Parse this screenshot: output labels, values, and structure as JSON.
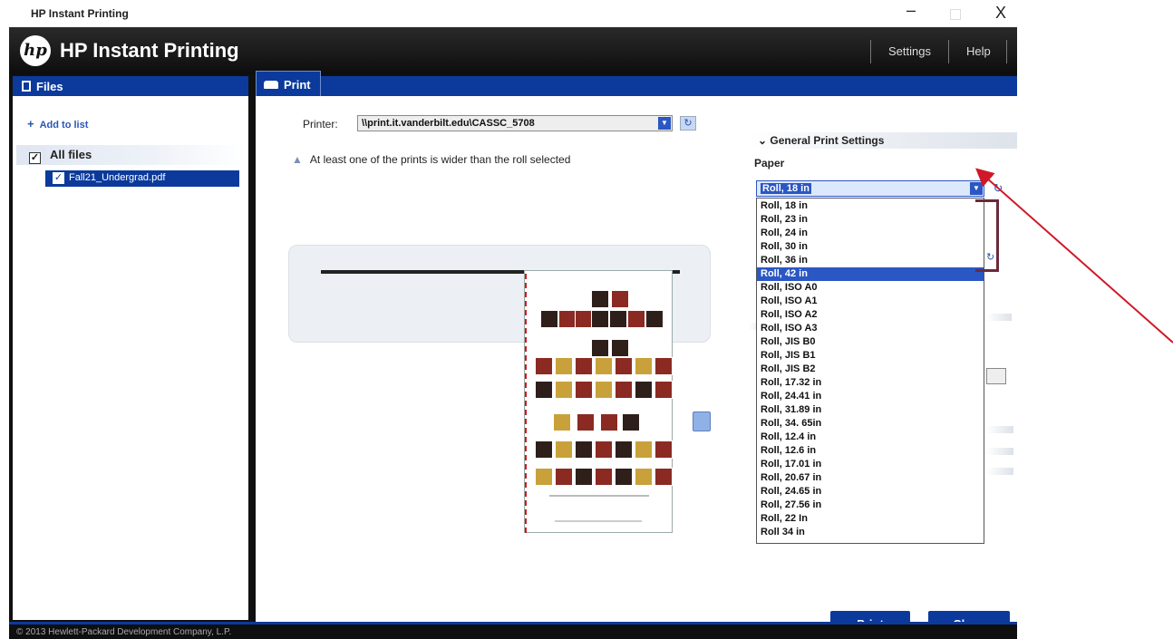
{
  "window": {
    "title": "HP Instant Printing",
    "minimize": "–",
    "maximize": "",
    "close": "X"
  },
  "header": {
    "logo": "hp",
    "title": "HP Instant Printing",
    "settings": "Settings",
    "help": "Help"
  },
  "files_pane": {
    "title": "Files",
    "add_to_list": "Add to list",
    "all_files": "All files",
    "files": [
      {
        "name": "Fall21_Undergrad.pdf",
        "checked": true
      }
    ]
  },
  "print_tab": {
    "label": "Print",
    "printer_label": "Printer:",
    "printer_value": "\\\\print.it.vanderbilt.edu\\CASSC_5708",
    "warning": "At least one of the prints is wider than the roll selected"
  },
  "settings": {
    "section_title": "General Print Settings",
    "paper_label": "Paper",
    "paper_selected": "Roll, 18 in",
    "paper_options": [
      "Roll, 18 in",
      "Roll, 23 in",
      "Roll, 24 in",
      "Roll, 30 in",
      "Roll, 36 in",
      "Roll, 42 in",
      "Roll, ISO A0",
      "Roll, ISO A1",
      "Roll, ISO A2",
      "Roll, ISO A3",
      "Roll, JIS B0",
      "Roll, JIS B1",
      "Roll, JIS B2",
      "Roll, 17.32 in",
      "Roll, 24.41 in",
      "Roll, 31.89 in",
      "Roll, 34. 65in",
      "Roll, 12.4 in",
      "Roll, 12.6 in",
      "Roll, 17.01 in",
      "Roll, 20.67 in",
      "Roll, 24.65 in",
      "Roll, 27.56 in",
      "Roll, 22 In",
      "Roll 34 in"
    ],
    "highlighted_option": "Roll, 42 in"
  },
  "buttons": {
    "print": "Print",
    "close": "Close"
  },
  "footer": {
    "copyright": "© 2013 Hewlett-Packard Development Company, L.P."
  },
  "colors": {
    "brand_blue": "#0b3a9c",
    "selection_blue": "#2b57c4",
    "annotation_red": "#d01828"
  }
}
